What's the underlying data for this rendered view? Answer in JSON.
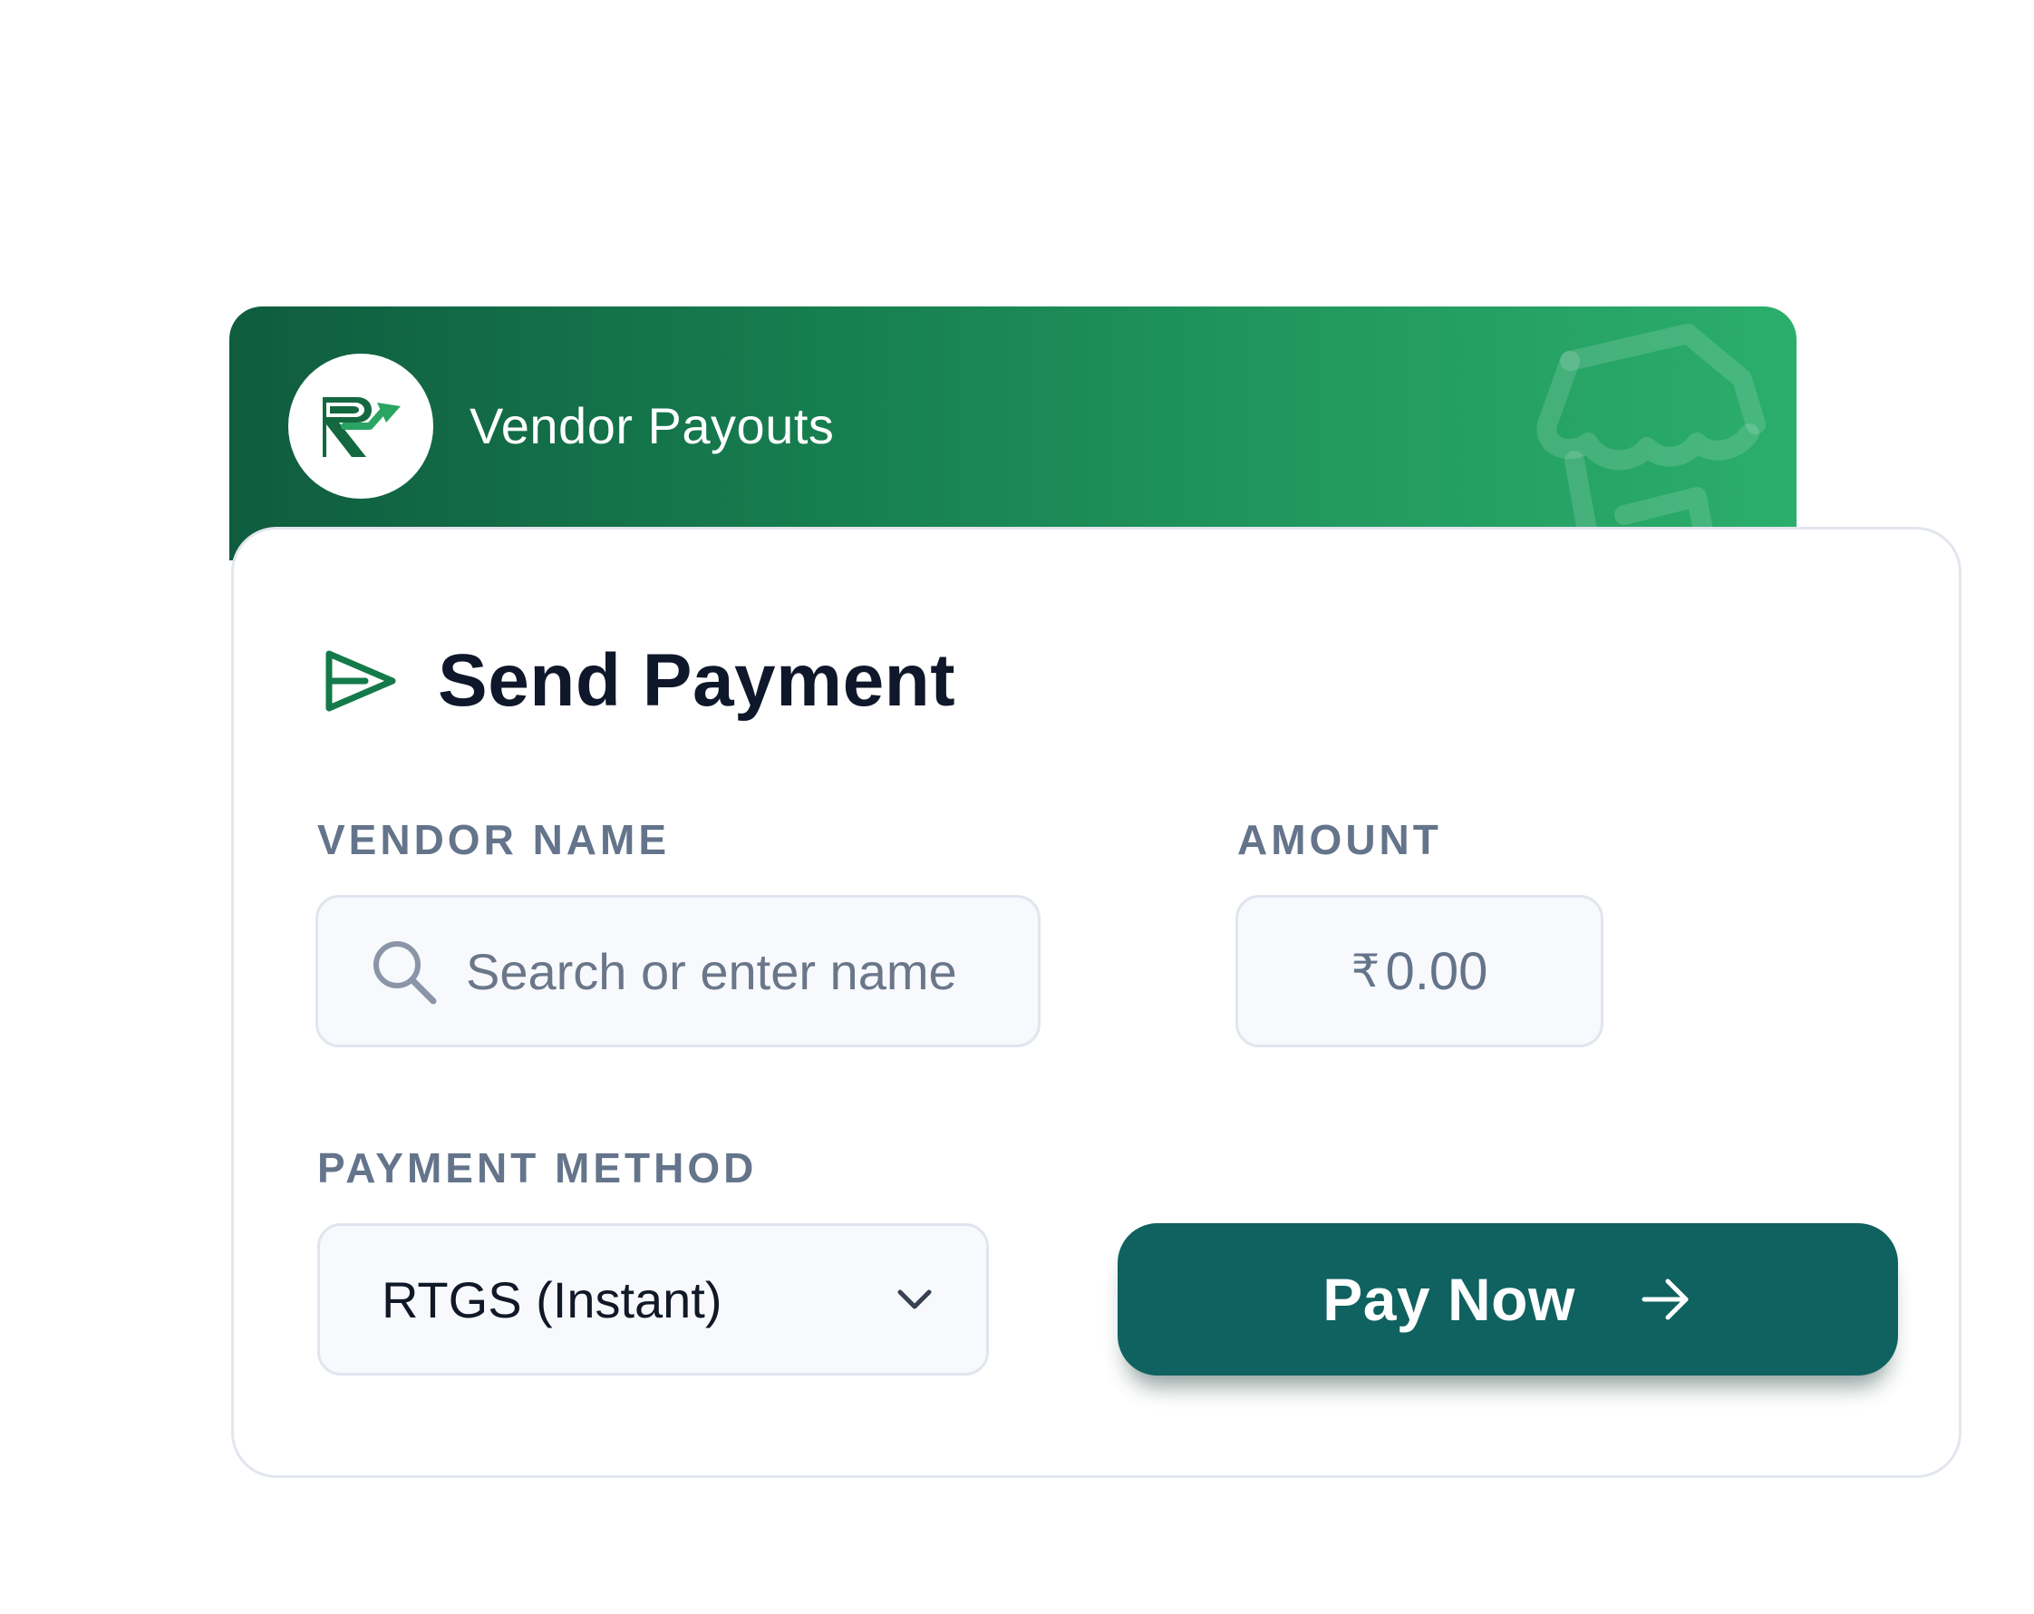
{
  "header": {
    "title": "Vendor Payouts",
    "logo_icon": "brand-logo-icon",
    "background_icon": "storefront-icon",
    "gradient_start": "#0f5c3f",
    "gradient_end": "#2bae6c"
  },
  "form": {
    "title": "Send Payment",
    "title_icon": "send-icon",
    "vendor": {
      "label": "VENDOR NAME",
      "placeholder": "Search or enter name",
      "icon": "search-icon"
    },
    "amount": {
      "label": "AMOUNT",
      "currency_symbol": "₹",
      "value": "0.00"
    },
    "payment_method": {
      "label": "PAYMENT METHOD",
      "selected": "RTGS (Instant)",
      "icon": "chevron-down-icon"
    },
    "submit": {
      "label": "Pay Now",
      "icon": "arrow-right-icon",
      "color": "#0f6260"
    }
  }
}
